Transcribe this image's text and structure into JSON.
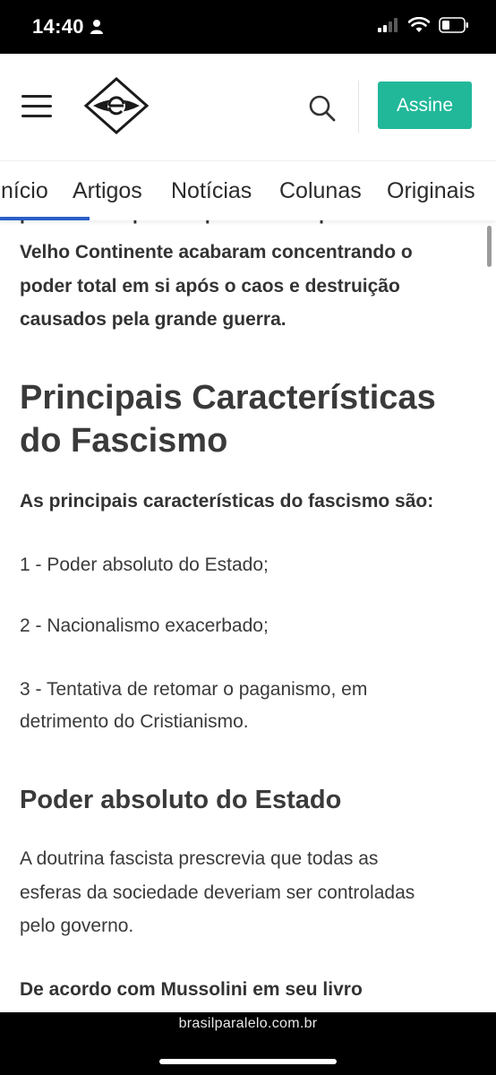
{
  "status_bar": {
    "time": "14:40",
    "icons": [
      "person-icon",
      "signal-icon",
      "wifi-icon",
      "battery-icon"
    ],
    "background": "#000000"
  },
  "header": {
    "menu_icon": "hamburger-menu-icon",
    "logo_icon": "brasil-paralelo-logo",
    "search_icon": "search-icon",
    "subscribe_label": "Assine",
    "subscribe_color": "#21b89a"
  },
  "nav": {
    "tabs": [
      {
        "label": "Início"
      },
      {
        "label": "Artigos"
      },
      {
        "label": "Notícias"
      },
      {
        "label": "Colunas"
      },
      {
        "label": "Originais"
      }
    ],
    "indicator_color": "#2a5ec9"
  },
  "article": {
    "intro_partial": "político europeu. As primeiras Repúblicas do",
    "intro_line_1": "Velho Continente acabaram concentrando o",
    "intro_line_2": "poder total em si após o caos e destruição",
    "intro_line_3": "causados pela grande guerra.",
    "heading_1_line_1": "Principais Características",
    "heading_1_line_2": "do Fascismo",
    "lead": "As principais características do fascismo são:",
    "item_1": "1 - Poder absoluto do Estado;",
    "item_2": "2 - Nacionalismo exacerbado;",
    "item_3_line_1": "3 - Tentativa de retomar o paganismo, em",
    "item_3_line_2": "detrimento do Cristianismo.",
    "heading_2": "Poder absoluto do Estado",
    "para_1_line_1": "A doutrina fascista prescrevia que todas as",
    "para_1_line_2": "esferas da sociedade deveriam ser controladas",
    "para_1_line_3": "pelo governo.",
    "para_2_line_1": "De acordo com Mussolini em seu livro"
  },
  "browser": {
    "url": "brasilparalelo.com.br"
  }
}
